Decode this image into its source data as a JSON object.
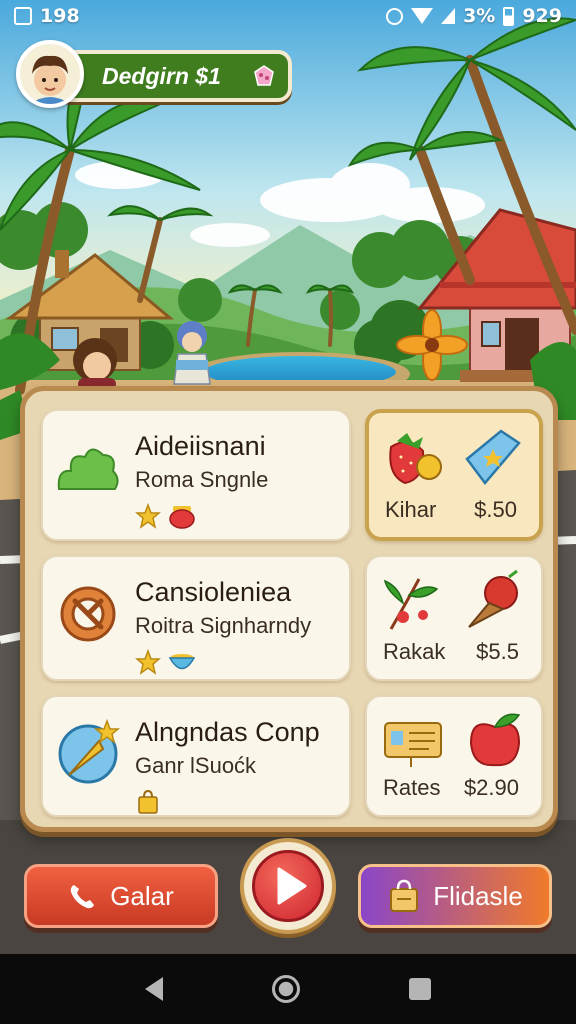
{
  "status_bar": {
    "time": "198",
    "battery": "3%",
    "clock": "929"
  },
  "player": {
    "name_label": "Dedgirn $1"
  },
  "quests": [
    {
      "title": "Aideiisnani",
      "subtitle": "Roma Sngnle",
      "icon": "bush-icon",
      "badges": [
        "star-icon",
        "red-pot-icon"
      ]
    },
    {
      "title": "Cansioleniea",
      "subtitle": "Roitra Signharndy",
      "icon": "pretzel-icon",
      "badges": [
        "star-icon",
        "blue-bowl-icon"
      ]
    },
    {
      "title": "Alngndas Conp",
      "subtitle": "Ganr lSuoćk",
      "icon": "compass-icon",
      "badges": [
        "bag-icon"
      ]
    }
  ],
  "rewards": [
    {
      "name": "Kihar",
      "price": "$.50",
      "icon_left": "strawberry-icon",
      "icon_right": "blue-gem-icon",
      "selected": true
    },
    {
      "name": "Rakak",
      "price": "$5.5",
      "icon_left": "berry-branch-icon",
      "icon_right": "ice-cream-icon",
      "selected": false
    },
    {
      "name": "Rates",
      "price": "$2.90",
      "icon_left": "ticket-icon",
      "icon_right": "apple-icon",
      "selected": false
    }
  ],
  "buttons": {
    "left_label": "Galar",
    "right_label": "Flidasle"
  },
  "colors": {
    "panel": "#e8d7b3",
    "panel_border": "#b98a4f",
    "pill_green": "#3f7d1f",
    "button_red": "#d84a2e",
    "button_purple": "#8a46c8",
    "button_orange": "#f07a2a",
    "play_red": "#cf2430"
  }
}
